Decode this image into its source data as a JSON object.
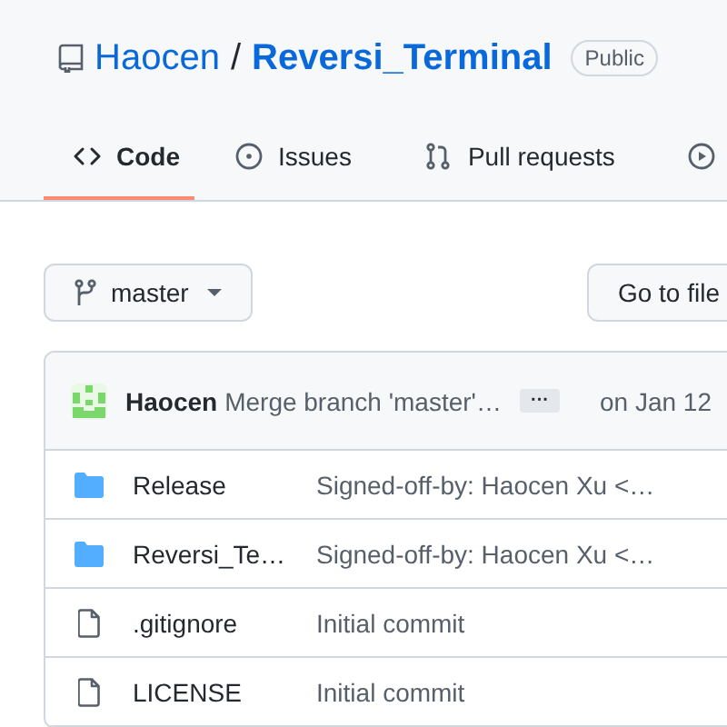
{
  "repo": {
    "owner": "Haocen",
    "name": "Reversi_Terminal",
    "separator": "/",
    "visibility": "Public"
  },
  "tabs": [
    {
      "kind": "code",
      "label": "Code",
      "selected": true
    },
    {
      "kind": "issues",
      "label": "Issues",
      "selected": false
    },
    {
      "kind": "pulls",
      "label": "Pull requests",
      "selected": false
    },
    {
      "kind": "actions",
      "selected": false
    }
  ],
  "branch": {
    "name": "master"
  },
  "go_to_file": "Go to file",
  "commit": {
    "author": "Haocen",
    "message": "Merge branch 'master'…",
    "more": "···",
    "date": "on Jan 12"
  },
  "files": [
    {
      "kind": "folder",
      "name": "Release",
      "message": "Signed-off-by: Haocen Xu <…"
    },
    {
      "kind": "folder",
      "name": "Reversi_Te…",
      "message": "Signed-off-by: Haocen Xu <…"
    },
    {
      "kind": "file",
      "name": ".gitignore",
      "message": "Initial commit"
    },
    {
      "kind": "file",
      "name": "LICENSE",
      "message": "Initial commit"
    }
  ]
}
